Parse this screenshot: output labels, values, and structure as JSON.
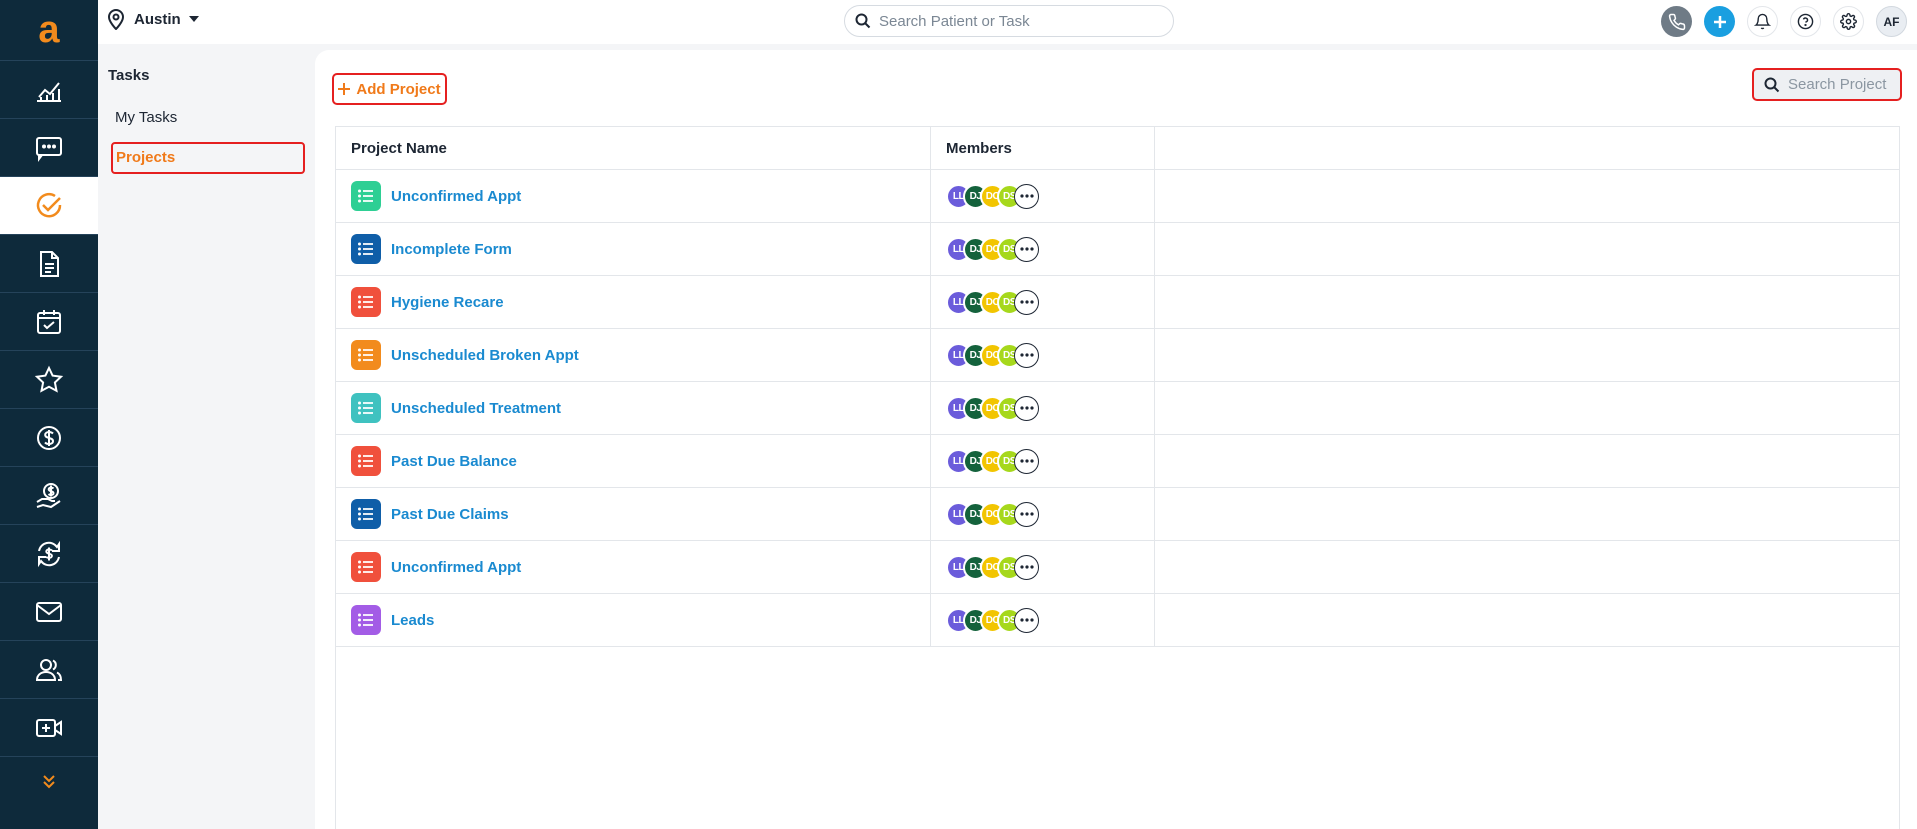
{
  "app": {
    "logo": "a",
    "location": "Austin",
    "search_placeholder": "Search Patient or Task",
    "user_initials": "AF"
  },
  "rail": {
    "items": [
      {
        "icon": "analytics-icon"
      },
      {
        "icon": "chat-icon"
      },
      {
        "icon": "tasks-check-icon",
        "active": true
      },
      {
        "icon": "document-icon"
      },
      {
        "icon": "calendar-check-icon"
      },
      {
        "icon": "star-icon"
      },
      {
        "icon": "dollar-circle-icon"
      },
      {
        "icon": "payment-hand-icon"
      },
      {
        "icon": "recurring-dollar-icon"
      },
      {
        "icon": "mail-icon"
      },
      {
        "icon": "users-icon"
      },
      {
        "icon": "video-add-icon"
      }
    ]
  },
  "subnav": {
    "title": "Tasks",
    "my_tasks": "My Tasks",
    "projects": "Projects"
  },
  "toolbar": {
    "add_project": "Add Project",
    "search_placeholder": "Search Project"
  },
  "table": {
    "headers": {
      "name": "Project Name",
      "members": "Members"
    },
    "member_initials": [
      "LL",
      "DJ",
      "DC",
      "DS"
    ],
    "member_colors": [
      "#6b5cdb",
      "#14623c",
      "#f2c500",
      "#a6d81c"
    ],
    "rows": [
      {
        "name": "Unconfirmed Appt",
        "color": "#2ecf94"
      },
      {
        "name": "Incomplete Form",
        "color": "#0f5ea8"
      },
      {
        "name": "Hygiene Recare",
        "color": "#f0503c"
      },
      {
        "name": "Unscheduled Broken Appt",
        "color": "#f28b1d"
      },
      {
        "name": "Unscheduled Treatment",
        "color": "#3fc2c0"
      },
      {
        "name": "Past Due Balance",
        "color": "#f0503c"
      },
      {
        "name": "Past Due Claims",
        "color": "#0f5ea8"
      },
      {
        "name": "Unconfirmed Appt",
        "color": "#f0503c"
      },
      {
        "name": "Leads",
        "color": "#a35ce6"
      }
    ]
  }
}
